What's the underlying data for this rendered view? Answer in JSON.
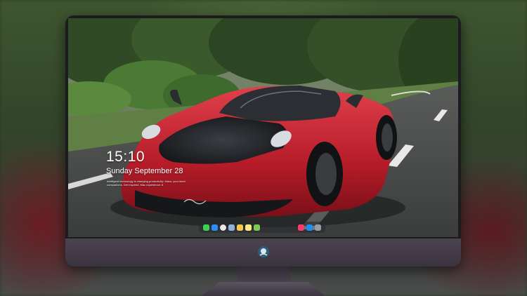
{
  "lock_screen": {
    "time": "15:10",
    "date": "Sunday September 28",
    "note": "Intelligent technology is changing productivity: Macs, your ideal companions. Get inspired. Mac experience: 8"
  },
  "dock": {
    "left_icons": [
      {
        "name": "messages-icon",
        "color": "#3ecf55"
      },
      {
        "name": "finder-icon",
        "color": "#2f8cf0"
      },
      {
        "name": "clock-icon",
        "color": "#e8e8e8"
      },
      {
        "name": "preview-icon",
        "color": "#8fb3d9"
      },
      {
        "name": "notes-icon",
        "color": "#f2c94c"
      },
      {
        "name": "notes-icon",
        "color": "#ffe680"
      },
      {
        "name": "photos-icon",
        "color": "#7ec850"
      }
    ],
    "right_icons": [
      {
        "name": "music-icon",
        "color": "#fc3d6b"
      },
      {
        "name": "app-store-icon",
        "color": "#1f8ef1"
      },
      {
        "name": "trash-icon",
        "color": "#9a9aa2"
      }
    ]
  }
}
